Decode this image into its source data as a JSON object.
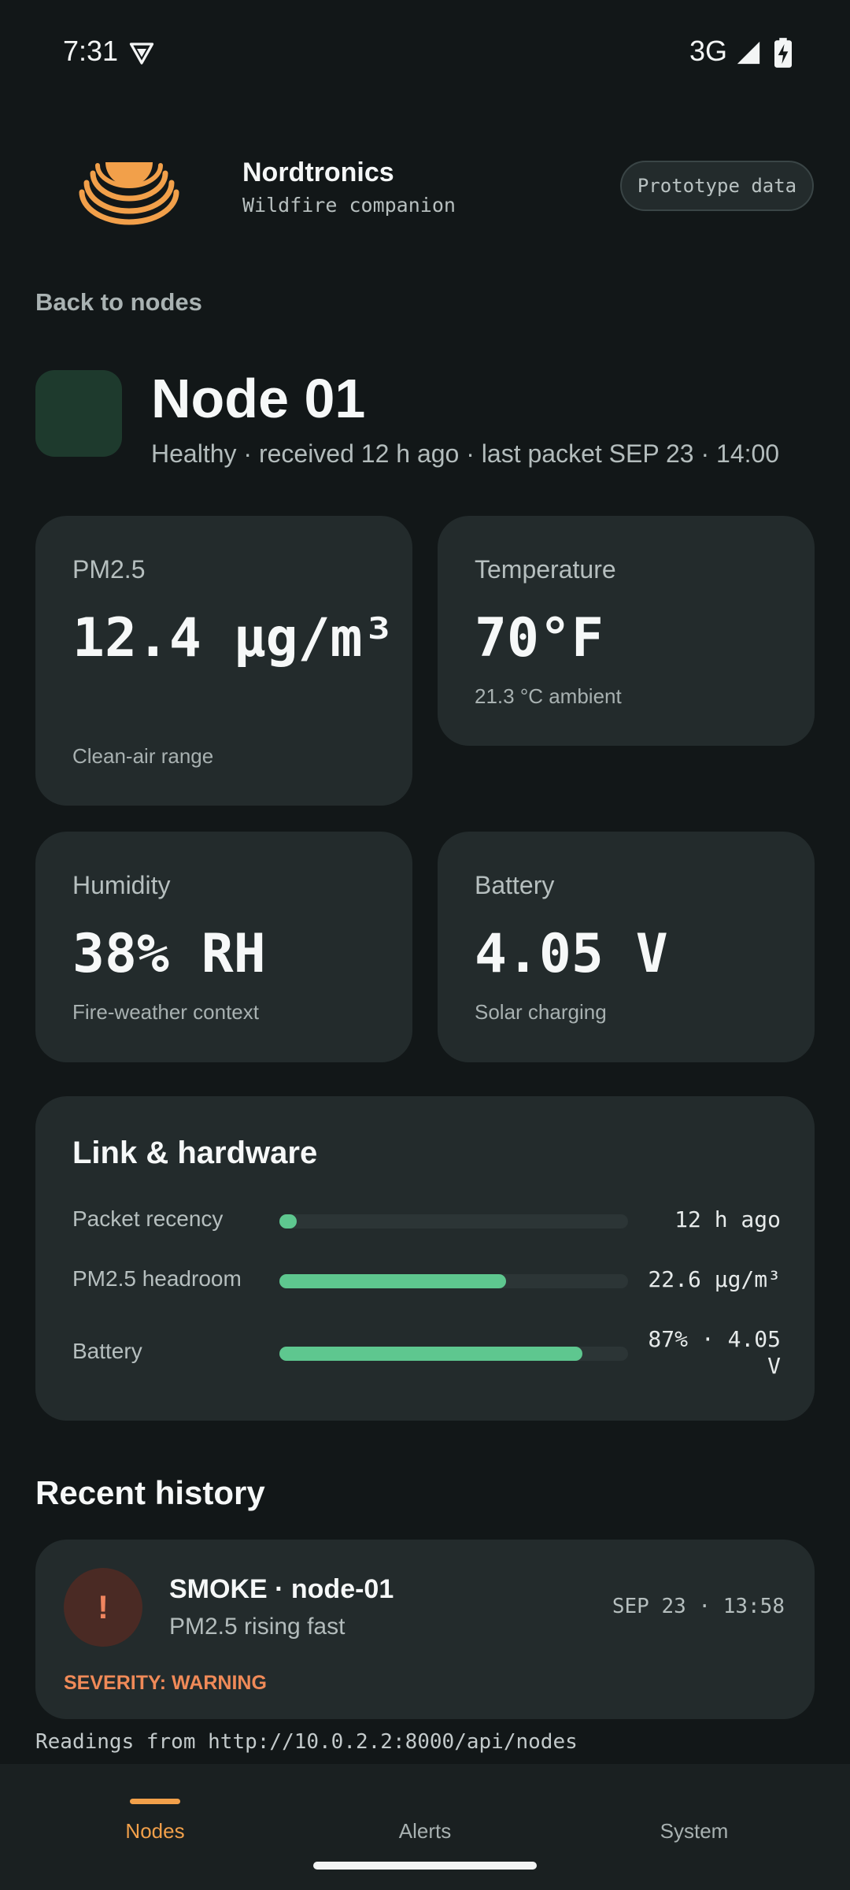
{
  "status_bar": {
    "time": "7:31",
    "network": "3G",
    "icons": [
      "vpn-shield-icon",
      "cell-signal-icon",
      "battery-charging-icon"
    ]
  },
  "header": {
    "brand_name": "Nordtronics",
    "brand_subtitle": "Wildfire companion",
    "badge": "Prototype data",
    "logo_icon": "signal-waves-logo-icon",
    "accent_color": "#f2a04a"
  },
  "back_link": "Back to nodes",
  "node": {
    "title": "Node 01",
    "subtitle": "Healthy · received 12 h ago · last packet SEP 23 · 14:00",
    "status_color": "#1e3a2d"
  },
  "metrics": {
    "pm25": {
      "label": "PM2.5",
      "value": "12.4 µg/m³",
      "note": "Clean-air range"
    },
    "temperature": {
      "label": "Temperature",
      "value": "70°F",
      "note": "21.3 °C ambient"
    },
    "humidity": {
      "label": "Humidity",
      "value": "38% RH",
      "note": "Fire-weather context"
    },
    "battery": {
      "label": "Battery",
      "value": "4.05 V",
      "note": "Solar charging"
    }
  },
  "link_hardware": {
    "title": "Link & hardware",
    "bar_color": "#5ec78f",
    "rows": [
      {
        "label": "Packet recency",
        "value": "12 h ago",
        "fill_percent": 5
      },
      {
        "label": "PM2.5 headroom",
        "value": "22.6 µg/m³",
        "fill_percent": 65
      },
      {
        "label": "Battery",
        "value": "87% · 4.05 V",
        "fill_percent": 87
      }
    ]
  },
  "history": {
    "title": "Recent history",
    "items": [
      {
        "badge": "!",
        "title": "SMOKE · node-01",
        "description": "PM2.5 rising fast",
        "time": "SEP 23 · 13:58",
        "severity": "SEVERITY: WARNING"
      }
    ]
  },
  "readings_source": "Readings from http://10.0.2.2:8000/api/nodes",
  "bottom_nav": {
    "items": [
      {
        "label": "Nodes",
        "active": true
      },
      {
        "label": "Alerts",
        "active": false
      },
      {
        "label": "System",
        "active": false
      }
    ]
  }
}
